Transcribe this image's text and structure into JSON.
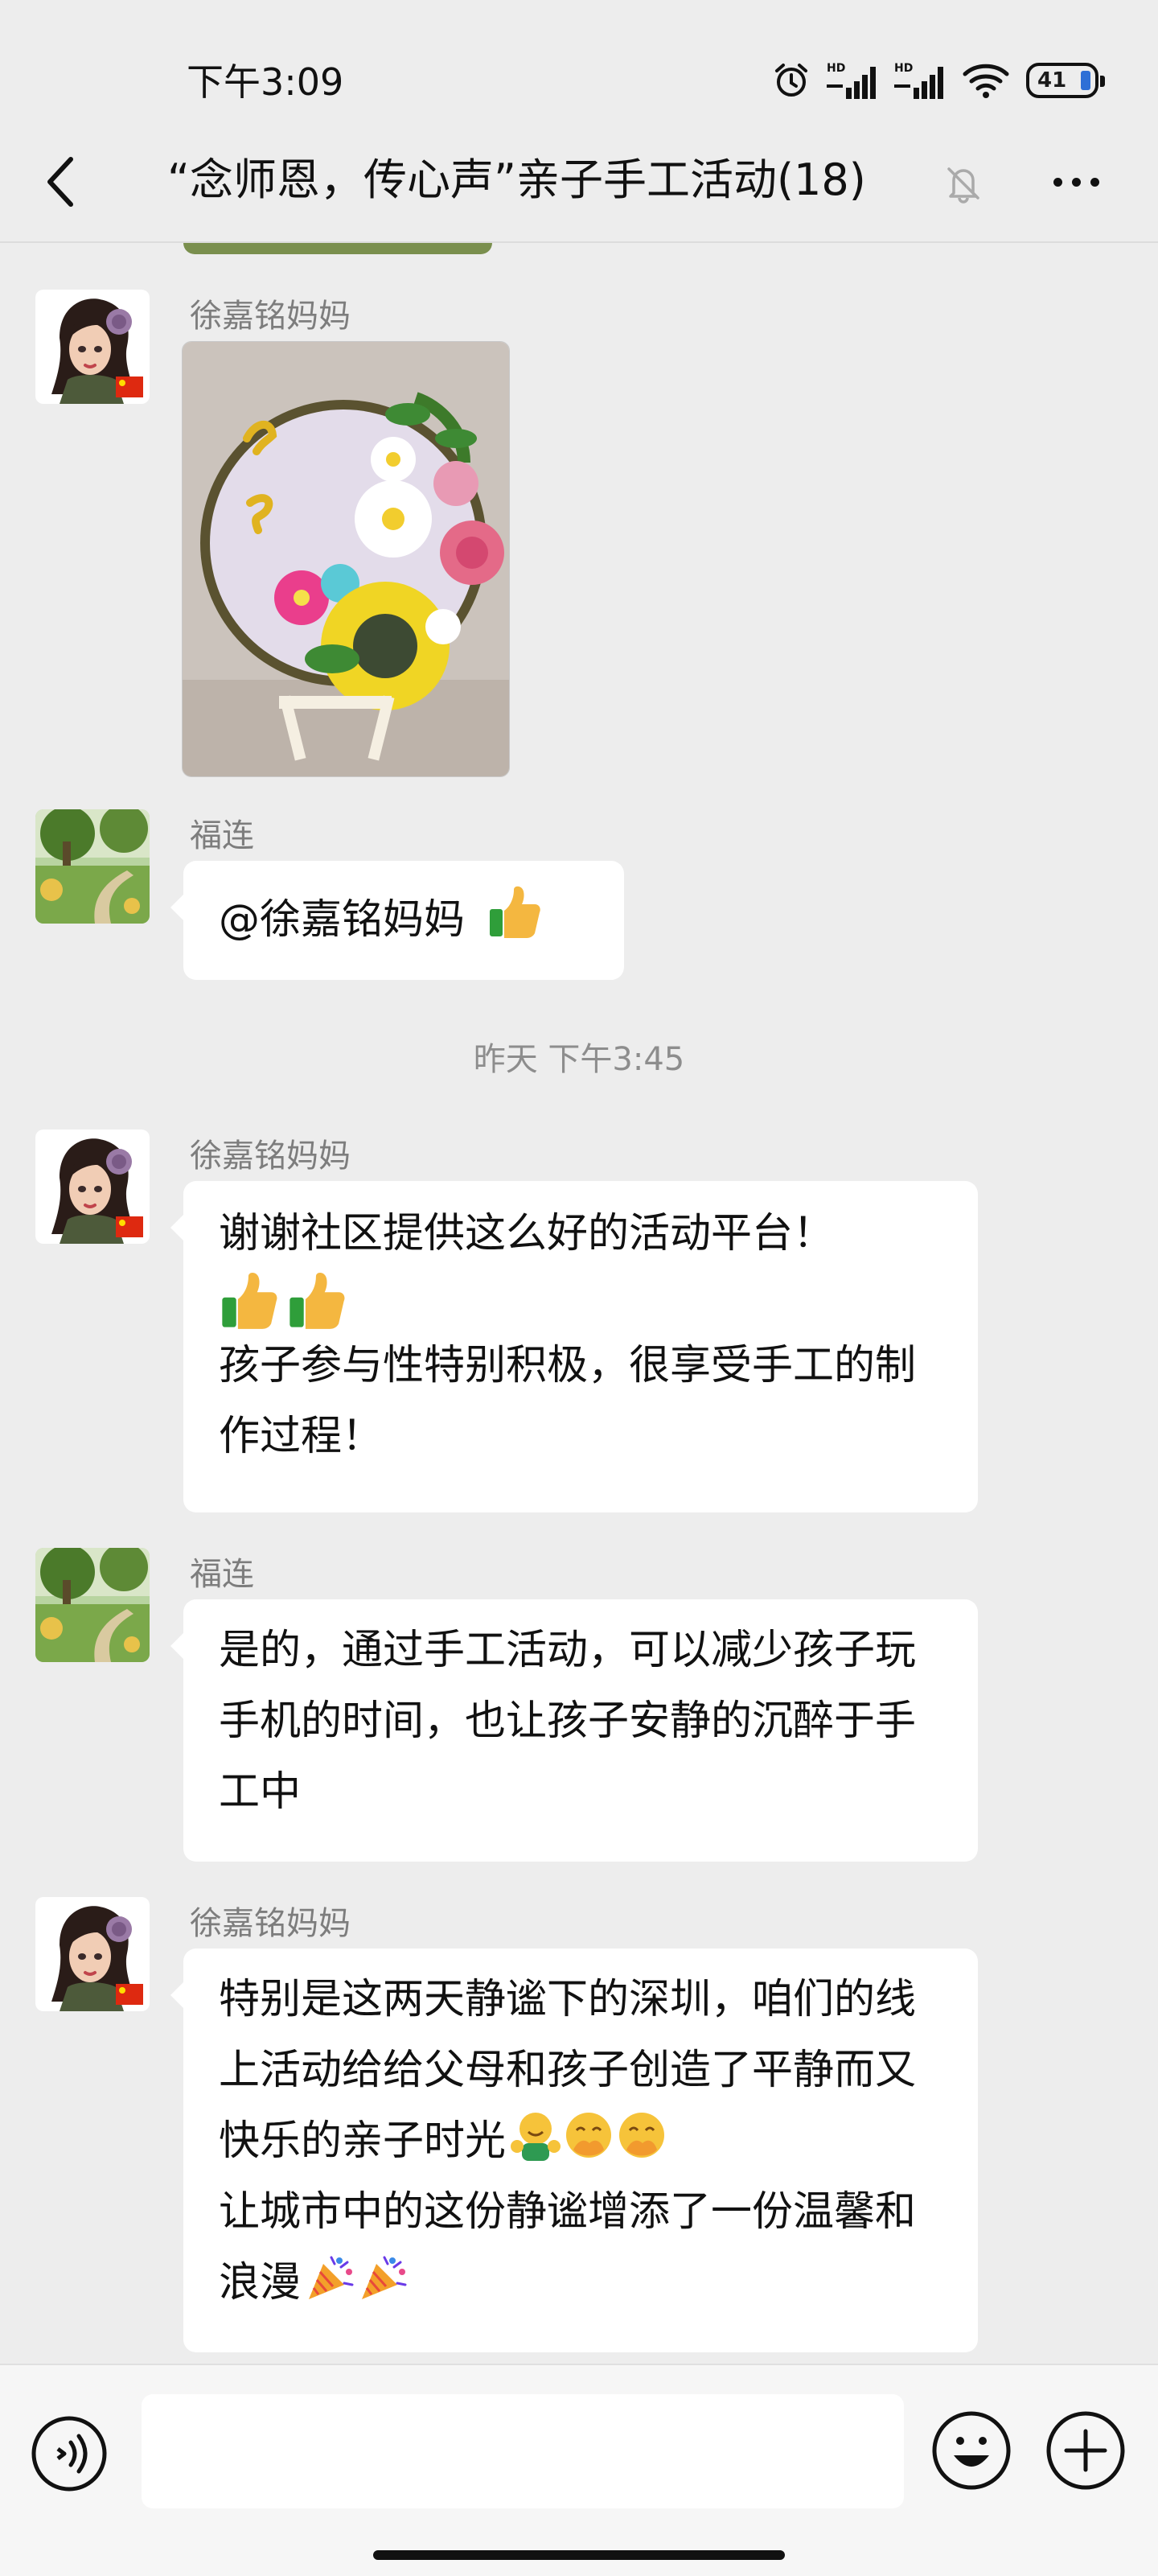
{
  "status_bar": {
    "time": "下午3:09",
    "battery": "41"
  },
  "header": {
    "title": "“念师恩，传心声”亲子手工活动(18)"
  },
  "messages": [
    {
      "type": "image",
      "sender": "徐嘉铭妈妈",
      "avatar": "woman-doll-avatar"
    },
    {
      "type": "text",
      "sender": "福连",
      "avatar": "garden-path-avatar",
      "text": "@徐嘉铭妈妈",
      "emoji": [
        "thumbs-up"
      ]
    },
    {
      "type": "divider",
      "text": "昨天 下午3:45"
    },
    {
      "type": "text",
      "sender": "徐嘉铭妈妈",
      "avatar": "woman-doll-avatar",
      "line1": "谢谢社区提供这么好的活动平台！",
      "line1_emoji": [
        "thumbs-up",
        "thumbs-up"
      ],
      "line2": "孩子参与性特别积极，很享受手工的制作过程！"
    },
    {
      "type": "text",
      "sender": "福连",
      "avatar": "garden-path-avatar",
      "text": "是的，通过手工活动，可以减少孩子玩手机的时间，也让孩子安静的沉醉于手工中"
    },
    {
      "type": "text",
      "sender": "徐嘉铭妈妈",
      "avatar": "woman-doll-avatar",
      "text_a": "特别是这两天静谧下的深圳，咱们的线上活动给给父母和孩子创造了平静而又快乐的亲子时光",
      "emoji_a": [
        "hugging-face",
        "face-with-hand-over-mouth",
        "face-with-hand-over-mouth"
      ],
      "text_b": "让城市中的这份静谧增添了一份温馨和浪漫",
      "emoji_b": [
        "party-popper",
        "party-popper"
      ]
    }
  ],
  "input_bar": {
    "placeholder": ""
  },
  "icons": [
    "back-arrow-icon",
    "mute-bell-icon",
    "more-icon",
    "voice-icon",
    "emoji-icon",
    "plus-icon"
  ],
  "colors": {
    "background": "#ededed",
    "bubble": "#ffffff",
    "sender": "#7d7d7d"
  }
}
